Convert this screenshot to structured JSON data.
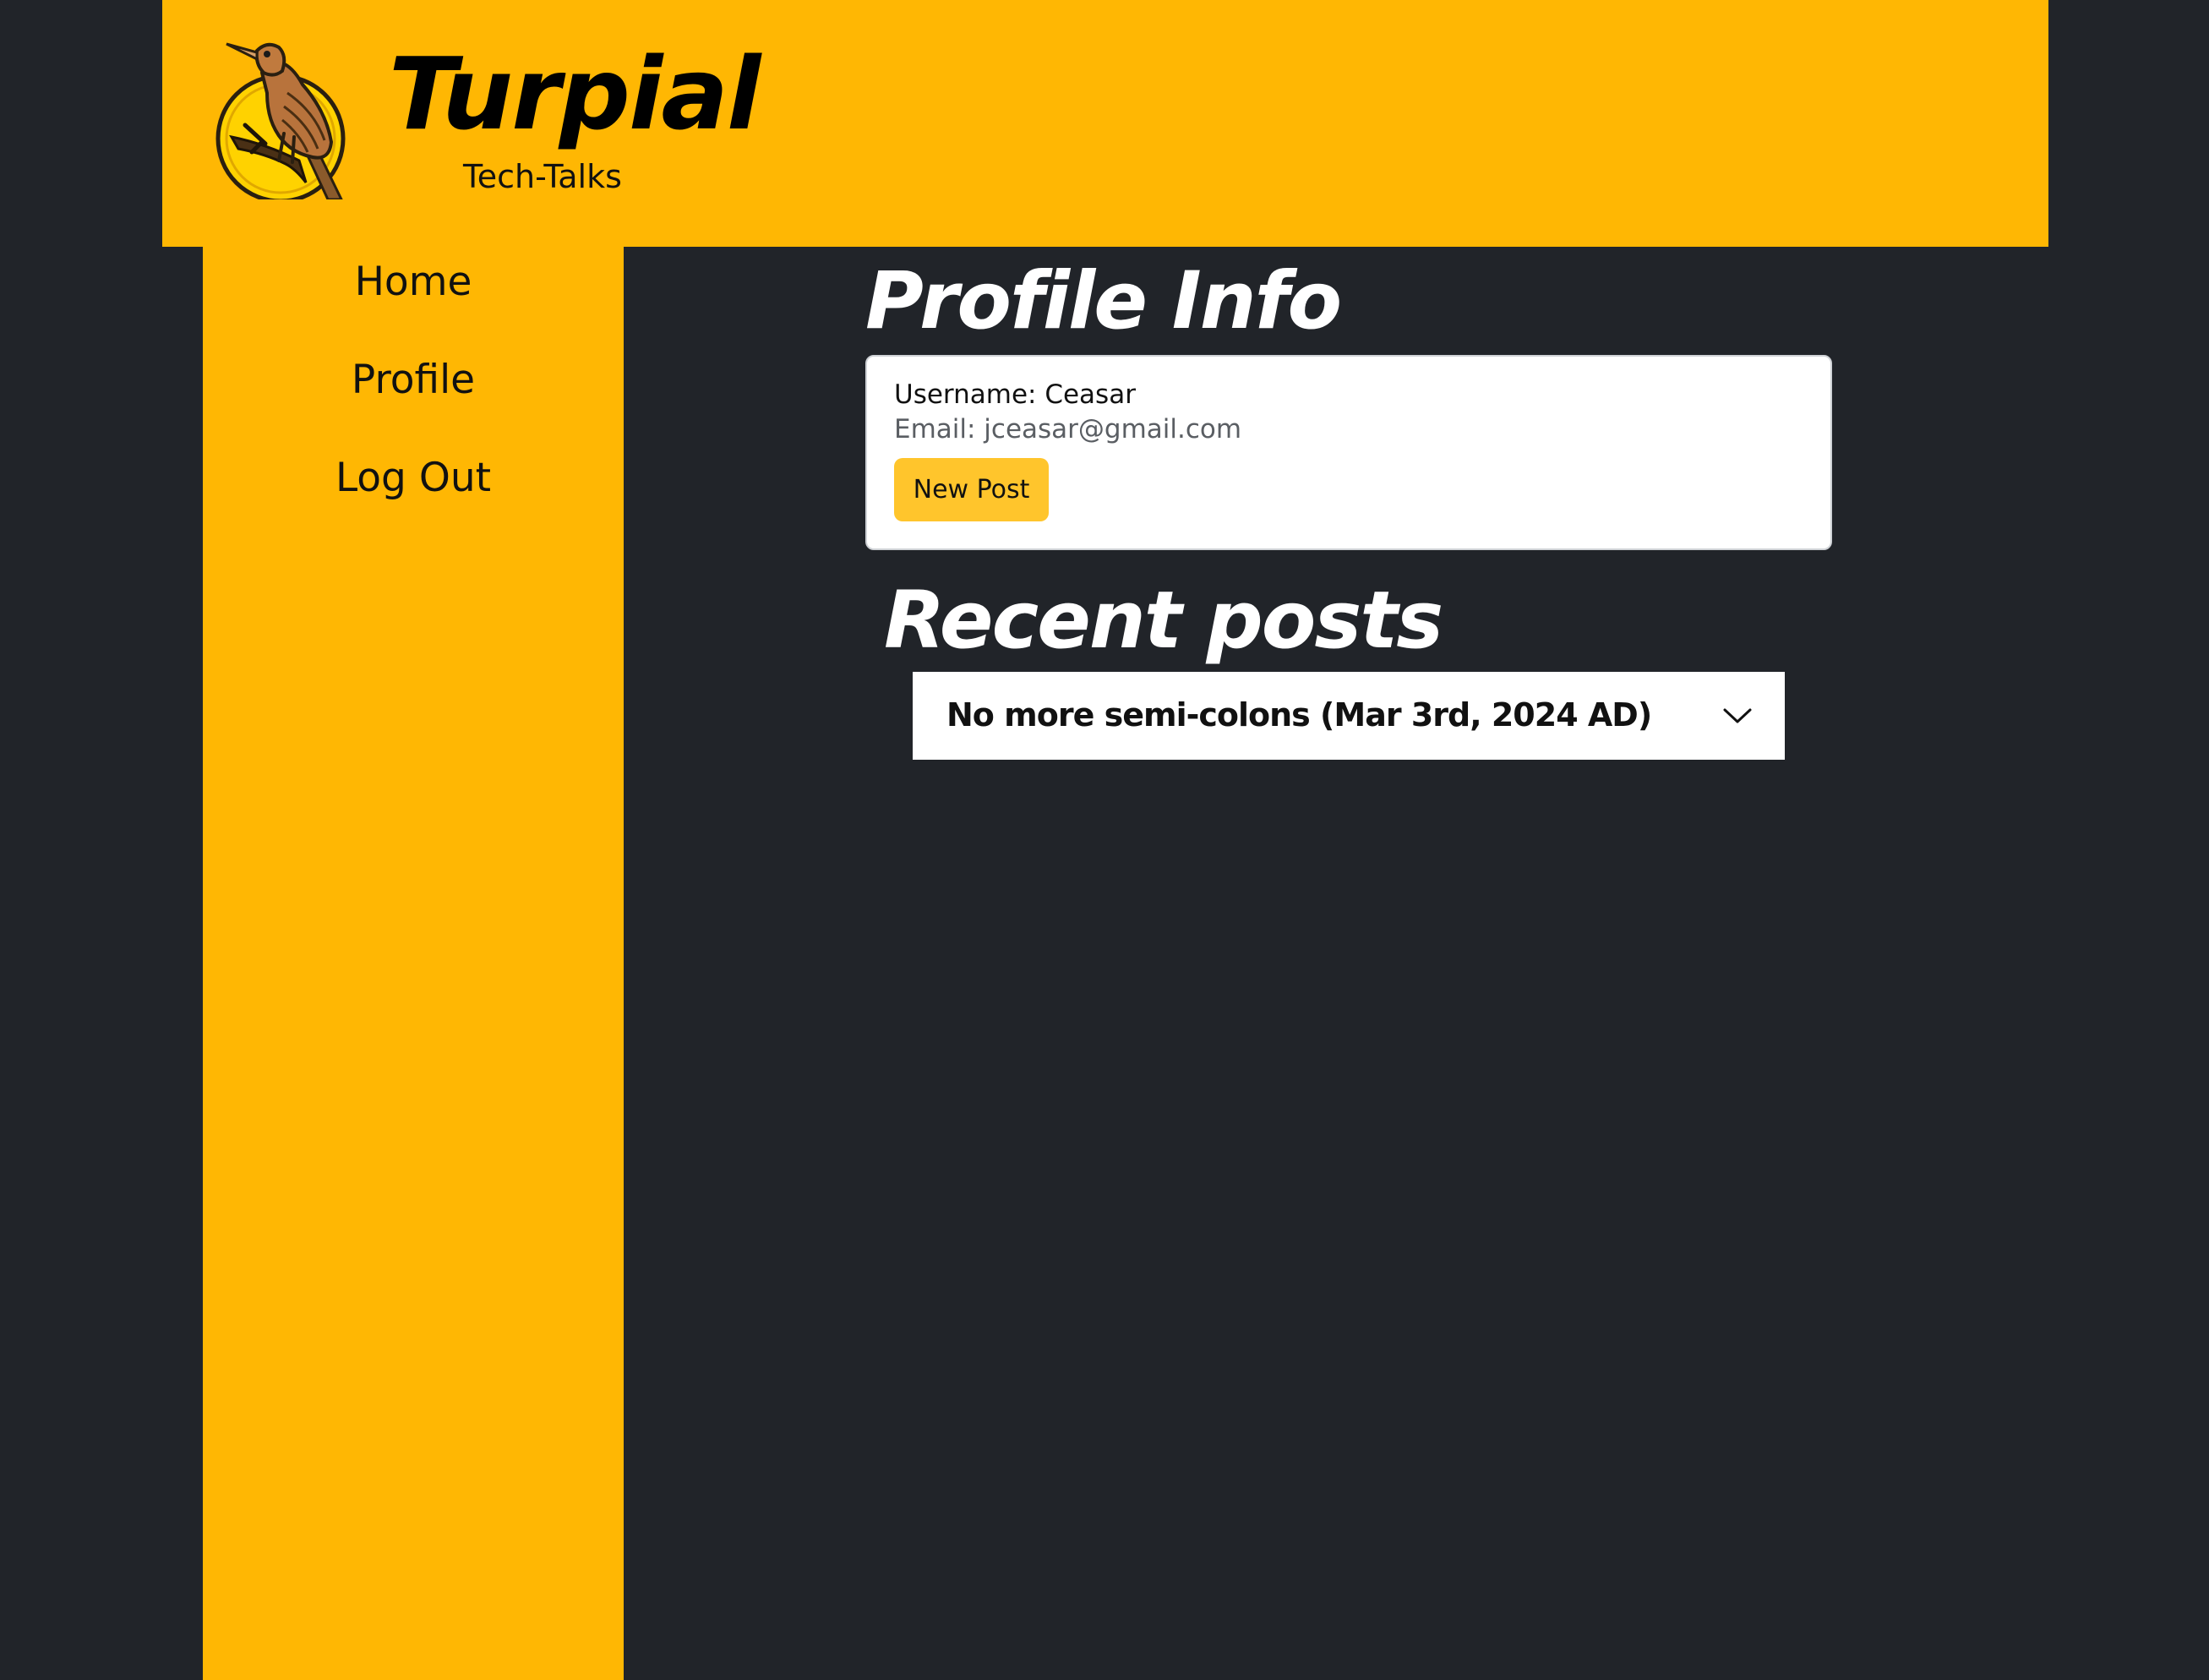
{
  "header": {
    "brand_name": "Turpial",
    "tagline": "Tech-Talks",
    "logo_icon": "turpial-bird-logo"
  },
  "sidebar": {
    "items": [
      {
        "label": "Home"
      },
      {
        "label": "Profile"
      },
      {
        "label": "Log Out"
      }
    ]
  },
  "profile": {
    "title": "Profile Info",
    "username_line": "Username: Ceasar",
    "email_line": "Email: jceasar@gmail.com",
    "new_post_label": "New Post"
  },
  "recent": {
    "title": "Recent posts",
    "posts": [
      {
        "title": "No more semi-colons (Mar 3rd, 2024 AD)",
        "expand_icon": "chevron-down-icon"
      }
    ]
  },
  "colors": {
    "accent": "#ffb703",
    "button": "#ffc52c",
    "background": "#212429"
  }
}
